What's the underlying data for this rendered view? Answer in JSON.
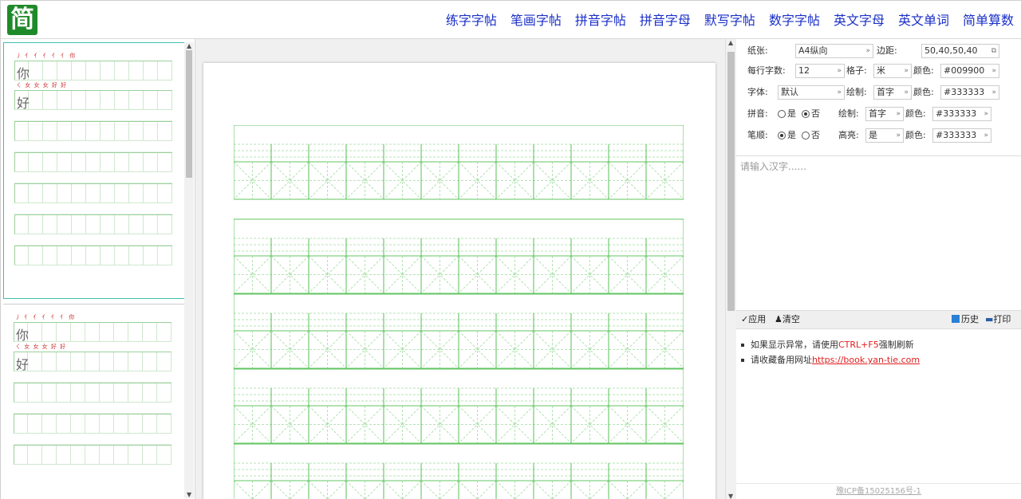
{
  "header": {
    "logo_char": "简",
    "nav": [
      "练字字帖",
      "笔画字帖",
      "拼音字帖",
      "拼音字母",
      "默写字帖",
      "数字字帖",
      "英文字母",
      "英文单词",
      "简单算数"
    ]
  },
  "thumbnails": {
    "page1": {
      "row1_strokes": "丿 亻 亻 亻 亻 亻 你",
      "row1_char": "你",
      "row2_strokes": "ㄑ 女 女 女 好 好",
      "row2_char": "好"
    },
    "page2": {
      "row1_strokes": "丿 亻 亻 亻 亻 亻 你",
      "row1_char": "你",
      "row2_strokes": "ㄑ 女 女 女 好 好",
      "row2_char": "好"
    }
  },
  "settings": {
    "paper_label": "纸张:",
    "paper_value": "A4纵向",
    "margin_label": "边距:",
    "margin_value": "50,40,50,40",
    "per_row_label": "每行字数:",
    "per_row_value": "12",
    "grid_label": "格子:",
    "grid_value": "米",
    "color_label": "颜色:",
    "grid_color": "#009900",
    "font_label": "字体:",
    "font_value": "默认",
    "draw_label": "绘制:",
    "font_draw_value": "首字",
    "font_color": "#333333",
    "pinyin_label": "拼音:",
    "pinyin_yes": "是",
    "pinyin_no": "否",
    "pinyin_selected": "否",
    "pinyin_draw_value": "首字",
    "pinyin_color": "#333333",
    "stroke_label": "笔顺:",
    "stroke_yes": "是",
    "stroke_no": "否",
    "stroke_selected": "是",
    "highlight_label": "高亮:",
    "highlight_value": "是",
    "stroke_color": "#333333"
  },
  "input": {
    "placeholder": "请输入汉字......"
  },
  "toolbar": {
    "apply": "✓应用",
    "clear": "♟清空",
    "history": "历史",
    "print": "打印"
  },
  "notes": {
    "note1_prefix": "如果显示异常，请使用",
    "note1_key": "CTRL+F5",
    "note1_suffix": "强制刷新",
    "note2_prefix": "请收藏备用网址",
    "note2_link": "https://book.yan-tie.com"
  },
  "footer": {
    "icp": "豫ICP备15025156号-1"
  },
  "colors": {
    "nav_link": "#1a2fc8",
    "grid_green": "#2bb02b",
    "accent_red": "#e02020",
    "logo_green": "#1f8a2a"
  }
}
